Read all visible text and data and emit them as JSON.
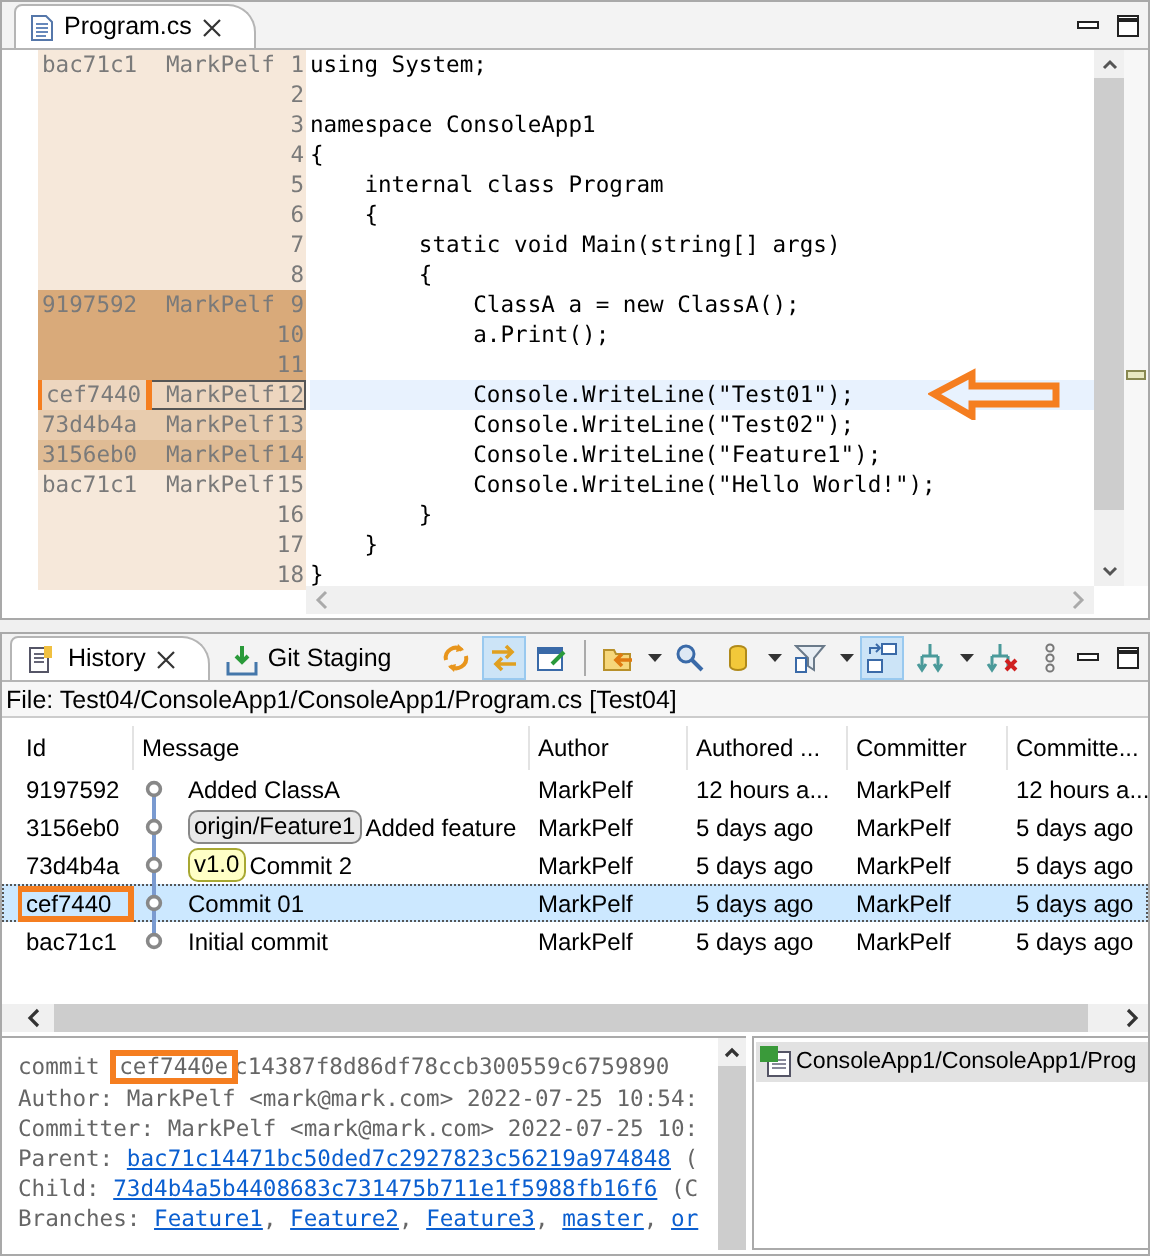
{
  "editor": {
    "tab": {
      "title": "Program.cs",
      "selected": true
    },
    "blame": [
      {
        "commit": "bac71c1",
        "author": "MarkPelf",
        "color": "#f6e8da",
        "selected": false,
        "highlighted": false,
        "line_numbers": [
          "1",
          "2",
          "3",
          "4",
          "5",
          "6",
          "7",
          "8"
        ]
      },
      {
        "commit": "9197592",
        "author": "MarkPelf",
        "color": "#d9aa7a",
        "selected": false,
        "highlighted": false,
        "line_numbers": [
          "9",
          "10",
          "11"
        ]
      },
      {
        "commit": "cef7440",
        "author": "MarkPelf",
        "color": "#edd6bf",
        "selected": true,
        "highlighted": true,
        "line_numbers": [
          "12"
        ]
      },
      {
        "commit": "73d4b4a",
        "author": "MarkPelf",
        "color": "#e8ccae",
        "selected": false,
        "highlighted": false,
        "line_numbers": [
          "13"
        ]
      },
      {
        "commit": "3156eb0",
        "author": "MarkPelf",
        "color": "#dfbb94",
        "selected": false,
        "highlighted": false,
        "line_numbers": [
          "14"
        ]
      },
      {
        "commit": "bac71c1",
        "author": "MarkPelf",
        "color": "#f6e8da",
        "selected": false,
        "highlighted": false,
        "line_numbers": [
          "15",
          "16",
          "17",
          "18"
        ]
      }
    ],
    "code_lines": [
      {
        "text": "using System;",
        "current": false,
        "arrow": false
      },
      {
        "current": false,
        "arrow": false
      },
      {
        "text": "namespace ConsoleApp1",
        "current": false,
        "arrow": false
      },
      {
        "text": "{",
        "current": false,
        "arrow": false
      },
      {
        "text": "    internal class Program",
        "current": false,
        "arrow": false
      },
      {
        "text": "    {",
        "current": false,
        "arrow": false
      },
      {
        "text": "        static void Main(string[] args)",
        "current": false,
        "arrow": false
      },
      {
        "text": "        {",
        "current": false,
        "arrow": false
      },
      {
        "text": "            ClassA a = new ClassA();",
        "current": false,
        "arrow": false
      },
      {
        "text": "            a.Print();",
        "current": false,
        "arrow": false
      },
      {
        "current": false,
        "arrow": false
      },
      {
        "text": "            Console.WriteLine(\"Test01\");",
        "current": true,
        "arrow": true
      },
      {
        "text": "            Console.WriteLine(\"Test02\");",
        "current": false,
        "arrow": false
      },
      {
        "text": "            Console.WriteLine(\"Feature1\");",
        "current": false,
        "arrow": false
      },
      {
        "text": "            Console.WriteLine(\"Hello World!\");",
        "current": false,
        "arrow": false
      },
      {
        "text": "        }",
        "current": false,
        "arrow": false
      },
      {
        "text": "    }",
        "current": false,
        "arrow": false
      },
      {
        "text": "}",
        "current": false,
        "arrow": false
      }
    ]
  },
  "history": {
    "tabs": [
      {
        "title": "History",
        "selected": true
      },
      {
        "title": "Git Staging",
        "selected": false
      }
    ],
    "toolbar": [
      {
        "selected": false,
        "dropdown": false
      },
      {
        "selected": true,
        "dropdown": false
      },
      {
        "selected": false,
        "dropdown": false
      },
      {
        "selected": false,
        "dropdown": true
      },
      {
        "selected": false,
        "dropdown": false
      },
      {
        "selected": false,
        "dropdown": true
      },
      {
        "selected": false,
        "dropdown": true
      },
      {
        "selected": true,
        "dropdown": false
      },
      {
        "selected": false,
        "dropdown": true
      },
      {
        "selected": false,
        "dropdown": false
      },
      {
        "selected": false,
        "dropdown": false
      }
    ],
    "file_label": "File: Test04/ConsoleApp1/ConsoleApp1/Program.cs [Test04]",
    "columns": [
      "Id",
      "Message",
      "Author",
      "Authored ...",
      "Committer",
      "Committe..."
    ],
    "rows": [
      {
        "id": "9197592",
        "refs": [],
        "message": "Added ClassA",
        "author": "MarkPelf",
        "authored": "12 hours a...",
        "committer": "MarkPelf",
        "committed": "12 hours a...",
        "selected": false,
        "highlighted": false
      },
      {
        "id": "3156eb0",
        "refs": [
          {
            "name": "origin/Feature1",
            "kind": "branch"
          }
        ],
        "message": "Added feature",
        "author": "MarkPelf",
        "authored": "5 days ago",
        "committer": "MarkPelf",
        "committed": "5 days ago",
        "selected": false,
        "highlighted": false
      },
      {
        "id": "73d4b4a",
        "refs": [
          {
            "name": "v1.0",
            "kind": "tag"
          }
        ],
        "message": "Commit 2",
        "author": "MarkPelf",
        "authored": "5 days ago",
        "committer": "MarkPelf",
        "committed": "5 days ago",
        "selected": false,
        "highlighted": false
      },
      {
        "id": "cef7440",
        "refs": [],
        "message": "Commit 01",
        "author": "MarkPelf",
        "authored": "5 days ago",
        "committer": "MarkPelf",
        "committed": "5 days ago",
        "selected": true,
        "highlighted": true
      },
      {
        "id": "bac71c1",
        "refs": [],
        "message": "Initial commit",
        "author": "MarkPelf",
        "authored": "5 days ago",
        "committer": "MarkPelf",
        "committed": "5 days ago",
        "selected": false,
        "highlighted": false
      }
    ],
    "details": [
      [
        {
          "text": "commit ",
          "link": false,
          "highlighted": false
        },
        {
          "text": "cef7440e",
          "link": false,
          "highlighted": true
        },
        {
          "text": "c14387f8d86df78ccb300559c6759890",
          "link": false,
          "highlighted": false
        }
      ],
      [
        {
          "text": "Author: MarkPelf <mark@mark.com> 2022-07-25 10:54:",
          "link": false,
          "highlighted": false
        }
      ],
      [
        {
          "text": "Committer: MarkPelf <mark@mark.com> 2022-07-25 10:",
          "link": false,
          "highlighted": false
        }
      ],
      [
        {
          "text": "Parent: ",
          "link": false,
          "highlighted": false
        },
        {
          "text": "bac71c14471bc50ded7c2927823c56219a974848",
          "link": true,
          "highlighted": false
        },
        {
          "text": " (",
          "link": false,
          "highlighted": false
        }
      ],
      [
        {
          "text": "Child: ",
          "link": false,
          "highlighted": false
        },
        {
          "text": "73d4b4a5b4408683c731475b711e1f5988fb16f6",
          "link": true,
          "highlighted": false
        },
        {
          "text": " (C",
          "link": false,
          "highlighted": false
        }
      ],
      [
        {
          "text": "Branches: ",
          "link": false,
          "highlighted": false
        },
        {
          "text": "Feature1",
          "link": true,
          "highlighted": false
        },
        {
          "text": ", ",
          "link": false,
          "highlighted": false
        },
        {
          "text": "Feature2",
          "link": true,
          "highlighted": false
        },
        {
          "text": ", ",
          "link": false,
          "highlighted": false
        },
        {
          "text": "Feature3",
          "link": true,
          "highlighted": false
        },
        {
          "text": ", ",
          "link": false,
          "highlighted": false
        },
        {
          "text": "master",
          "link": true,
          "highlighted": false
        },
        {
          "text": ", ",
          "link": false,
          "highlighted": false
        },
        {
          "text": "or",
          "link": true,
          "highlighted": false
        }
      ]
    ],
    "files": [
      {
        "path": "ConsoleApp1/ConsoleApp1/Prog",
        "selected": true
      }
    ]
  }
}
